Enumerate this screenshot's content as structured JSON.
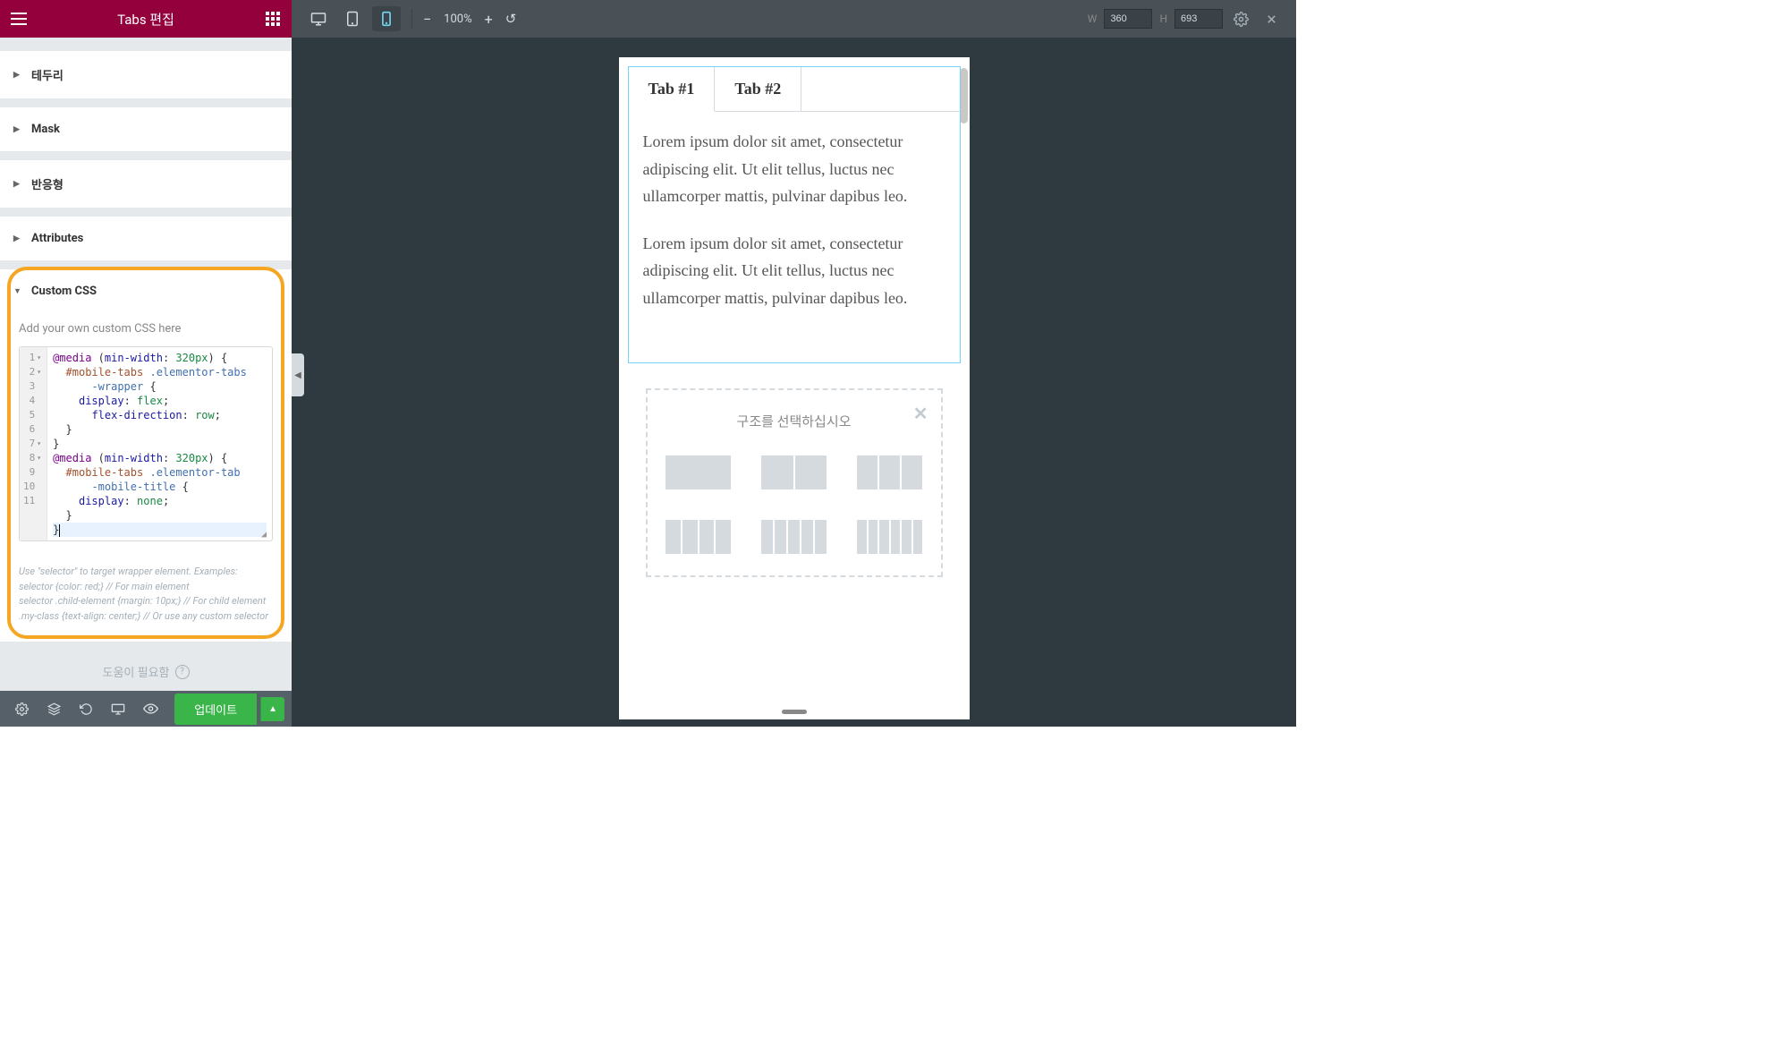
{
  "panel": {
    "title": "Tabs 편집",
    "accordion": {
      "border": "테두리",
      "mask": "Mask",
      "responsive": "반응형",
      "attributes": "Attributes",
      "customCss": "Custom CSS"
    },
    "cssHint": "Add your own custom CSS here",
    "code": {
      "lines": [
        "1",
        "2",
        "3",
        "4",
        "5",
        "6",
        "7",
        "8",
        "9",
        "10",
        "11"
      ]
    },
    "helpText": "Use \"selector\" to target wrapper element. Examples:\nselector {color: red;} // For main element\nselector .child-element {margin: 10px;} // For child element\n.my-class {text-align: center;} // Or use any custom selector",
    "needHelp": "도움이 필요함",
    "updateBtn": "업데이트"
  },
  "toolbar": {
    "zoom": "100%",
    "wLabel": "W",
    "hLabel": "H",
    "wVal": "360",
    "hVal": "693"
  },
  "preview": {
    "tabs": [
      "Tab #1",
      "Tab #2"
    ],
    "content1": "Lorem ipsum dolor sit amet, consectetur adipiscing elit. Ut elit tellus, luctus nec ullamcorper mattis, pulvinar dapibus leo.",
    "content2": "Lorem ipsum dolor sit amet, consectetur adipiscing elit. Ut elit tellus, luctus nec ullamcorper mattis, pulvinar dapibus leo.",
    "structureTitle": "구조를 선택하십시오"
  }
}
